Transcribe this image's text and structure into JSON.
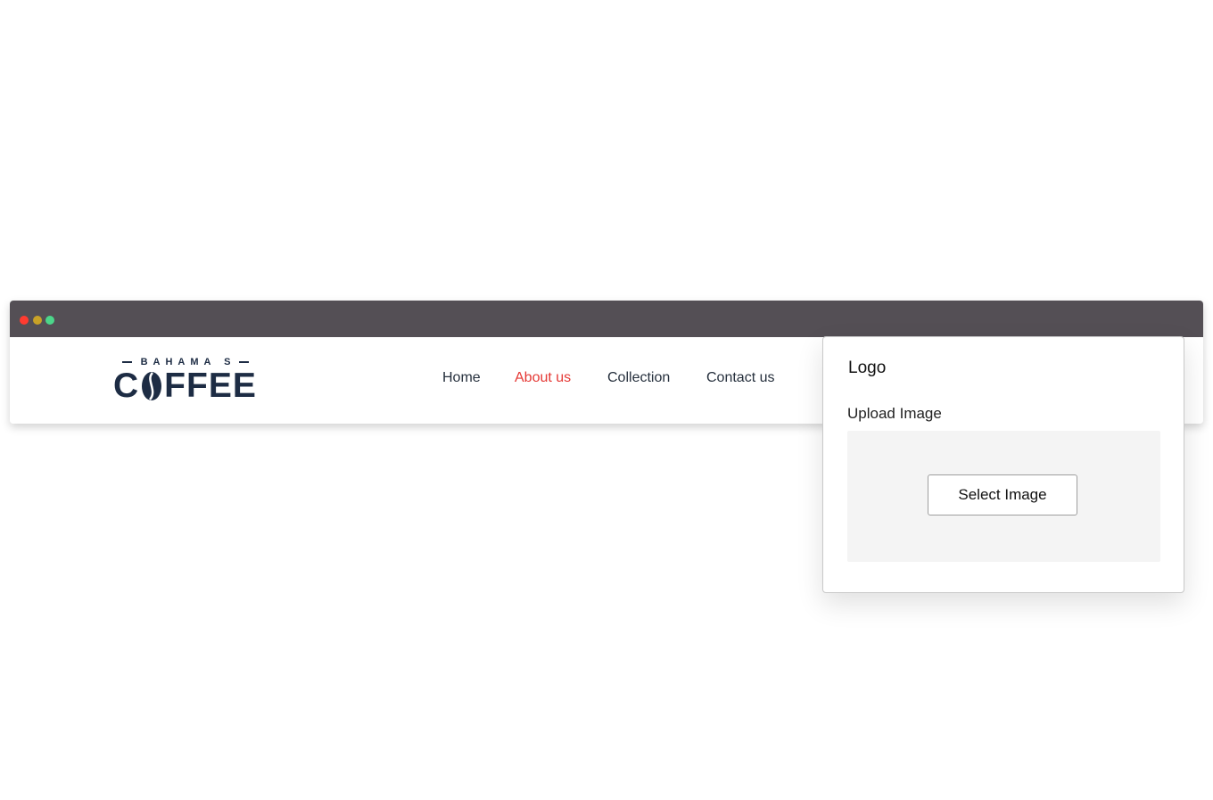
{
  "window": {
    "controls": [
      "close",
      "minimize",
      "maximize"
    ]
  },
  "logo": {
    "top_text": "BAHAMA S",
    "main_left": "C",
    "main_right": "FFEE",
    "icon": "coffee-bean-icon",
    "color": "#1d2c44"
  },
  "nav": {
    "items": [
      {
        "label": "Home",
        "active": false
      },
      {
        "label": "About us",
        "active": true
      },
      {
        "label": "Collection",
        "active": false
      },
      {
        "label": "Contact us",
        "active": false
      }
    ],
    "active_color": "#e53935"
  },
  "panel": {
    "title": "Logo",
    "upload_label": "Upload Image",
    "button_label": "Select Image"
  },
  "colors": {
    "titlebar": "#544f55",
    "close": "#ff3b30",
    "minimize": "#c9a227",
    "maximize": "#4cd68a"
  }
}
